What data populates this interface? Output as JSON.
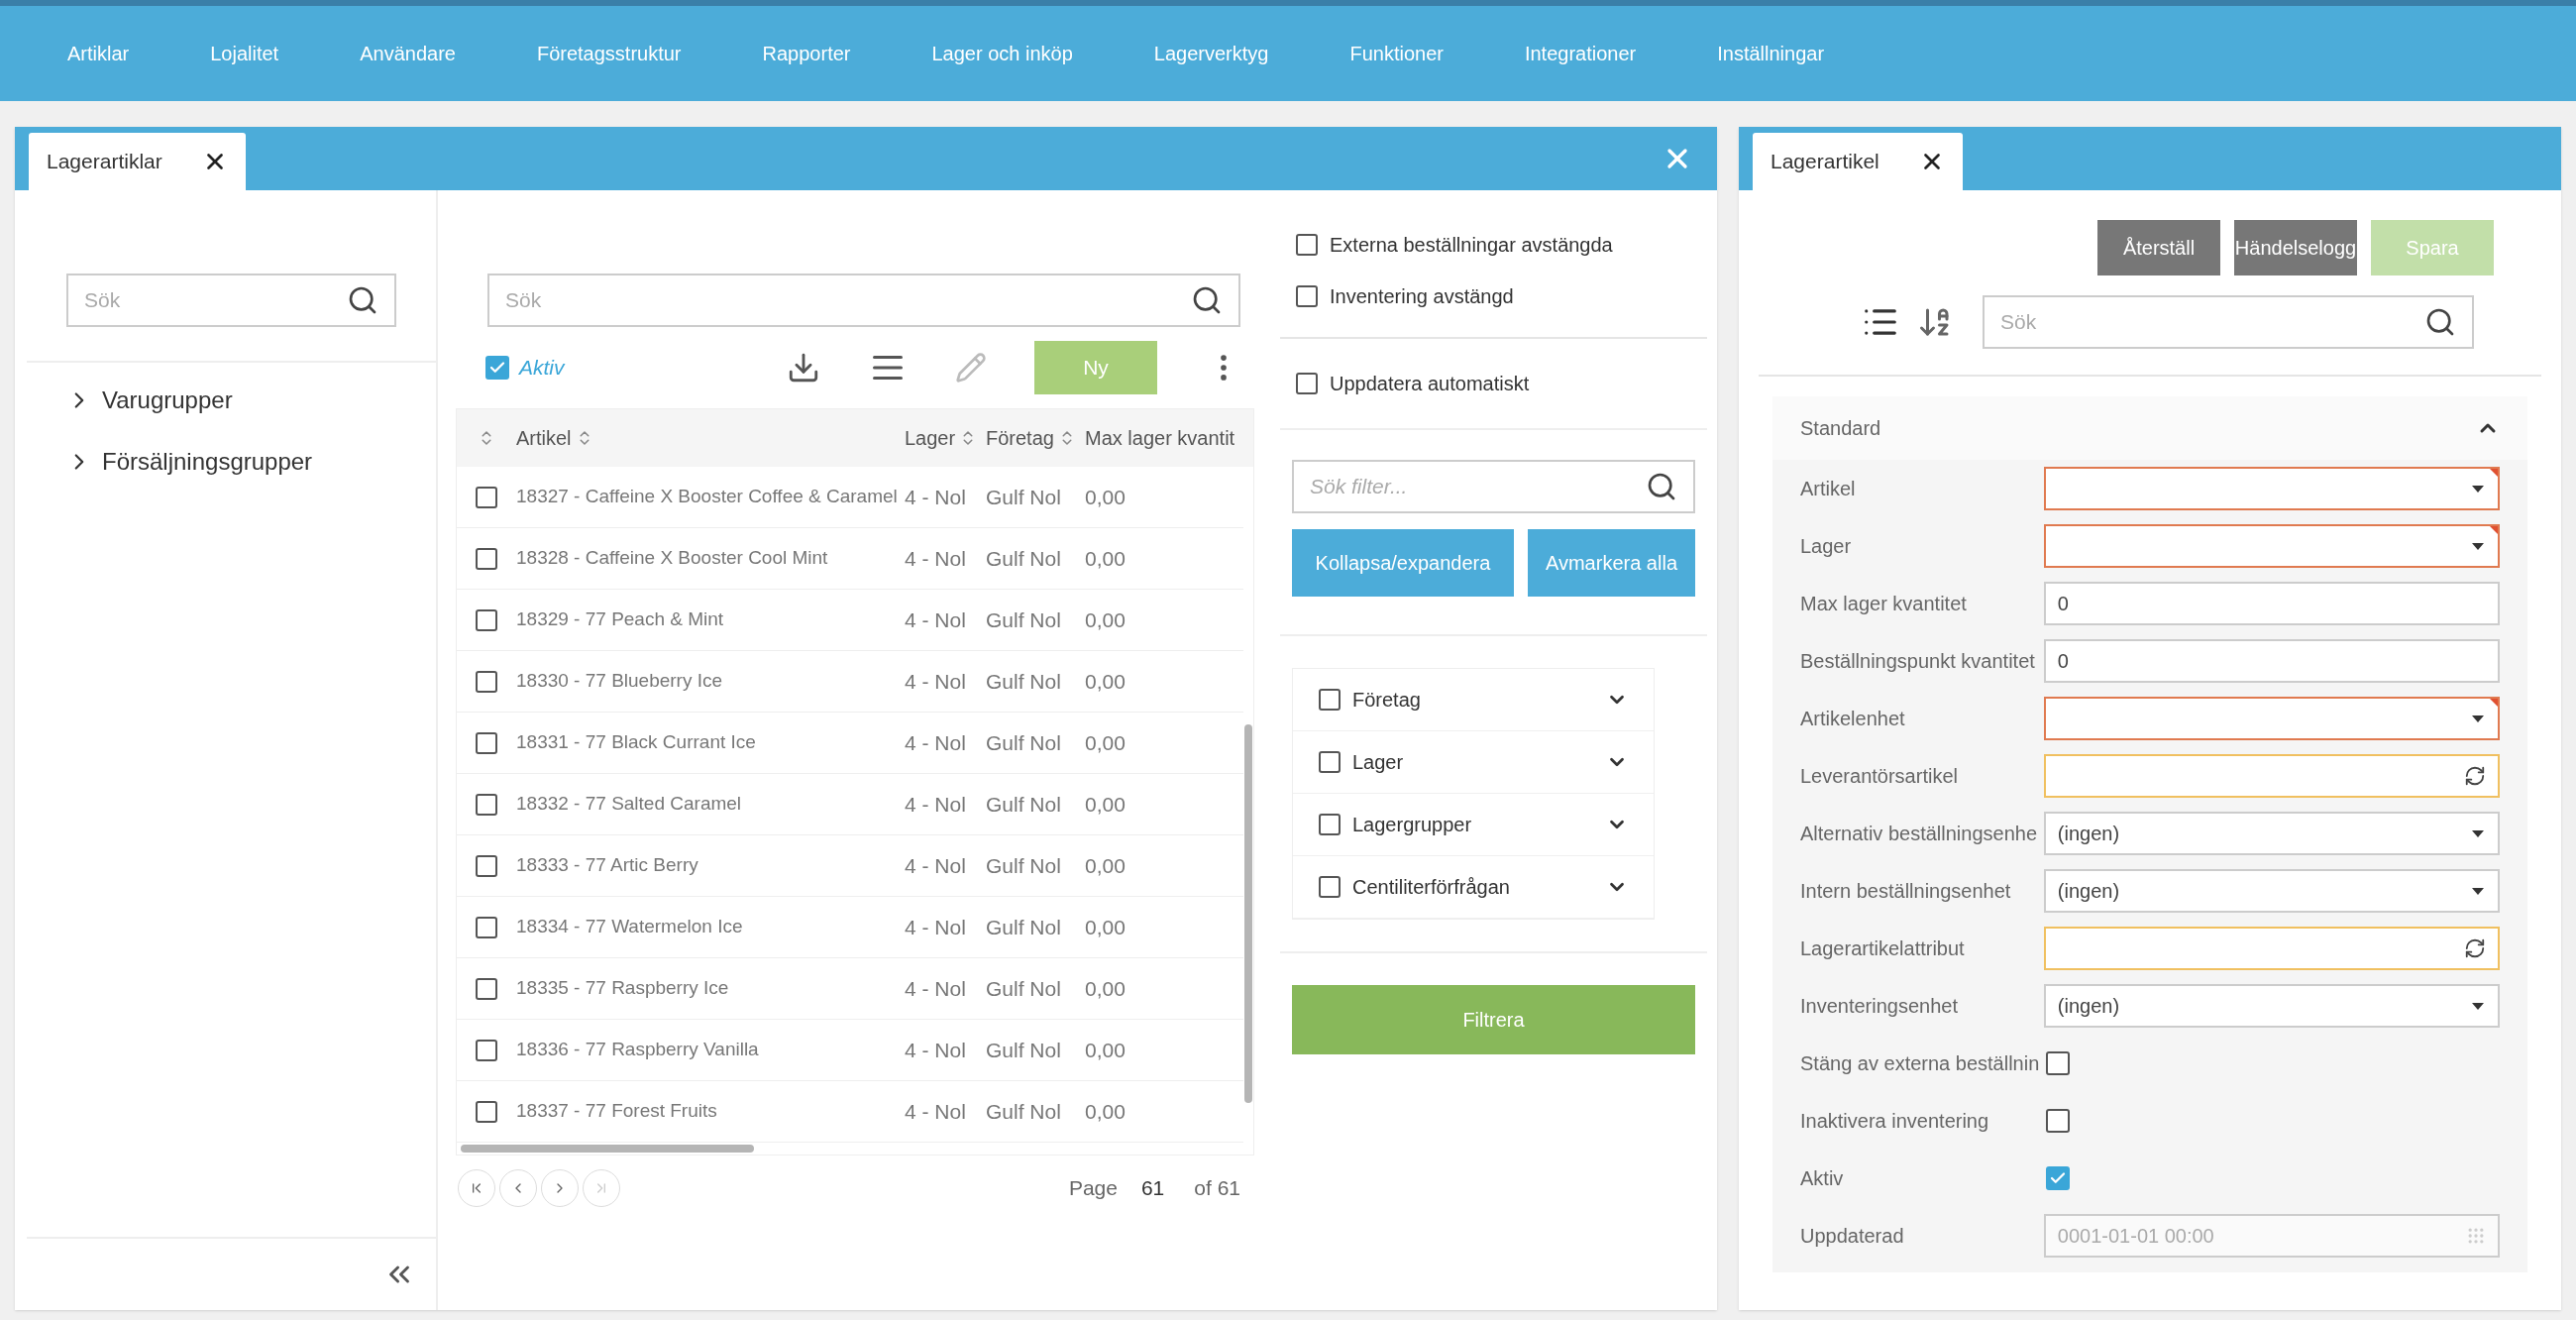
{
  "nav": {
    "items": [
      "Artiklar",
      "Lojalitet",
      "Användare",
      "Företagsstruktur",
      "Rapporter",
      "Lager och inköp",
      "Lagerverktyg",
      "Funktioner",
      "Integrationer",
      "Inställningar"
    ]
  },
  "left_window": {
    "tab": {
      "label": "Lagerartiklar"
    },
    "tree": {
      "search": {
        "placeholder": "Sök"
      },
      "items": [
        {
          "label": "Varugrupper",
          "expanded": false
        },
        {
          "label": "Försäljningsgrupper",
          "expanded": false
        }
      ]
    },
    "list": {
      "search": {
        "placeholder": "Sök"
      },
      "active_filter": {
        "label": "Aktiv",
        "checked": true
      },
      "new_button": "Ny",
      "columns": [
        "Artikel",
        "Lager",
        "Företag",
        "Max lager kvantit"
      ],
      "rows": [
        {
          "checked": false,
          "cells": [
            "18327 - Caffeine X Booster Coffee & Caramel",
            "4 - Nol",
            "Gulf Nol",
            "0,00"
          ]
        },
        {
          "checked": false,
          "cells": [
            "18328 - Caffeine X Booster Cool Mint",
            "4 - Nol",
            "Gulf Nol",
            "0,00"
          ]
        },
        {
          "checked": false,
          "cells": [
            "18329 - 77 Peach & Mint",
            "4 - Nol",
            "Gulf Nol",
            "0,00"
          ]
        },
        {
          "checked": false,
          "cells": [
            "18330 - 77 Blueberry Ice",
            "4 - Nol",
            "Gulf Nol",
            "0,00"
          ]
        },
        {
          "checked": false,
          "cells": [
            "18331 - 77 Black Currant Ice",
            "4 - Nol",
            "Gulf Nol",
            "0,00"
          ]
        },
        {
          "checked": false,
          "cells": [
            "18332 - 77 Salted Caramel",
            "4 - Nol",
            "Gulf Nol",
            "0,00"
          ]
        },
        {
          "checked": false,
          "cells": [
            "18333 - 77 Artic Berry",
            "4 - Nol",
            "Gulf Nol",
            "0,00"
          ]
        },
        {
          "checked": false,
          "cells": [
            "18334 - 77 Watermelon Ice",
            "4 - Nol",
            "Gulf Nol",
            "0,00"
          ]
        },
        {
          "checked": false,
          "cells": [
            "18335 - 77 Raspberry Ice",
            "4 - Nol",
            "Gulf Nol",
            "0,00"
          ]
        },
        {
          "checked": false,
          "cells": [
            "18336 - 77 Raspberry Vanilla",
            "4 - Nol",
            "Gulf Nol",
            "0,00"
          ]
        },
        {
          "checked": false,
          "cells": [
            "18337 - 77 Forest Fruits",
            "4 - Nol",
            "Gulf Nol",
            "0,00"
          ]
        }
      ],
      "pager": {
        "page_label": "Page",
        "page": "61",
        "total": "of 61"
      }
    },
    "filters": {
      "options": [
        {
          "label": "Externa beställningar avstängda",
          "checked": false
        },
        {
          "label": "Inventering avstängd",
          "checked": false
        }
      ],
      "auto_update": {
        "label": "Uppdatera automatiskt",
        "checked": false
      },
      "search": {
        "placeholder": "Sök filter..."
      },
      "buttons": [
        "Kollapsa/expandera",
        "Avmarkera alla"
      ],
      "groups": [
        {
          "label": "Företag",
          "checked": false
        },
        {
          "label": "Lager",
          "checked": false
        },
        {
          "label": "Lagergrupper",
          "checked": false
        },
        {
          "label": "Centiliterförfrågan",
          "checked": false
        }
      ],
      "apply_button": "Filtrera"
    }
  },
  "right_window": {
    "tab": {
      "label": "Lagerartikel"
    },
    "buttons": [
      {
        "label": "Återställ",
        "disabled": false
      },
      {
        "label": "Händelselogg",
        "disabled": false
      },
      {
        "label": "Spara",
        "disabled": true
      }
    ],
    "search": {
      "placeholder": "Sök"
    },
    "section": {
      "title": "Standard",
      "expanded": true,
      "fields": [
        {
          "label": "Artikel",
          "kind": "select",
          "required": true
        },
        {
          "label": "Lager",
          "kind": "select",
          "required": true
        },
        {
          "label": "Max lager kvantitet",
          "kind": "input",
          "required": false,
          "value": "0"
        },
        {
          "label": "Beställningspunkt kvantitet",
          "kind": "input",
          "required": false,
          "value": "0"
        },
        {
          "label": "Artikelenhet",
          "kind": "select",
          "required": true
        },
        {
          "label": "Leverantörsartikel",
          "kind": "lookup",
          "required": false
        },
        {
          "label": "Alternativ beställningsenhe",
          "kind": "select",
          "required": false,
          "value": "(ingen)"
        },
        {
          "label": "Intern beställningsenhet",
          "kind": "select",
          "required": false,
          "value": "(ingen)"
        },
        {
          "label": "Lagerartikelattribut",
          "kind": "lookup",
          "required": false
        },
        {
          "label": "Inventeringsenhet",
          "kind": "select",
          "required": false,
          "value": "(ingen)"
        },
        {
          "label": "Stäng av externa beställnin",
          "kind": "checkbox",
          "checked": false
        },
        {
          "label": "Inaktivera inventering",
          "kind": "checkbox",
          "checked": false
        },
        {
          "label": "Aktiv",
          "kind": "checkbox",
          "checked": true
        },
        {
          "label": "Uppdaterad",
          "kind": "date",
          "value": "0001-01-01 00:00"
        }
      ]
    }
  }
}
